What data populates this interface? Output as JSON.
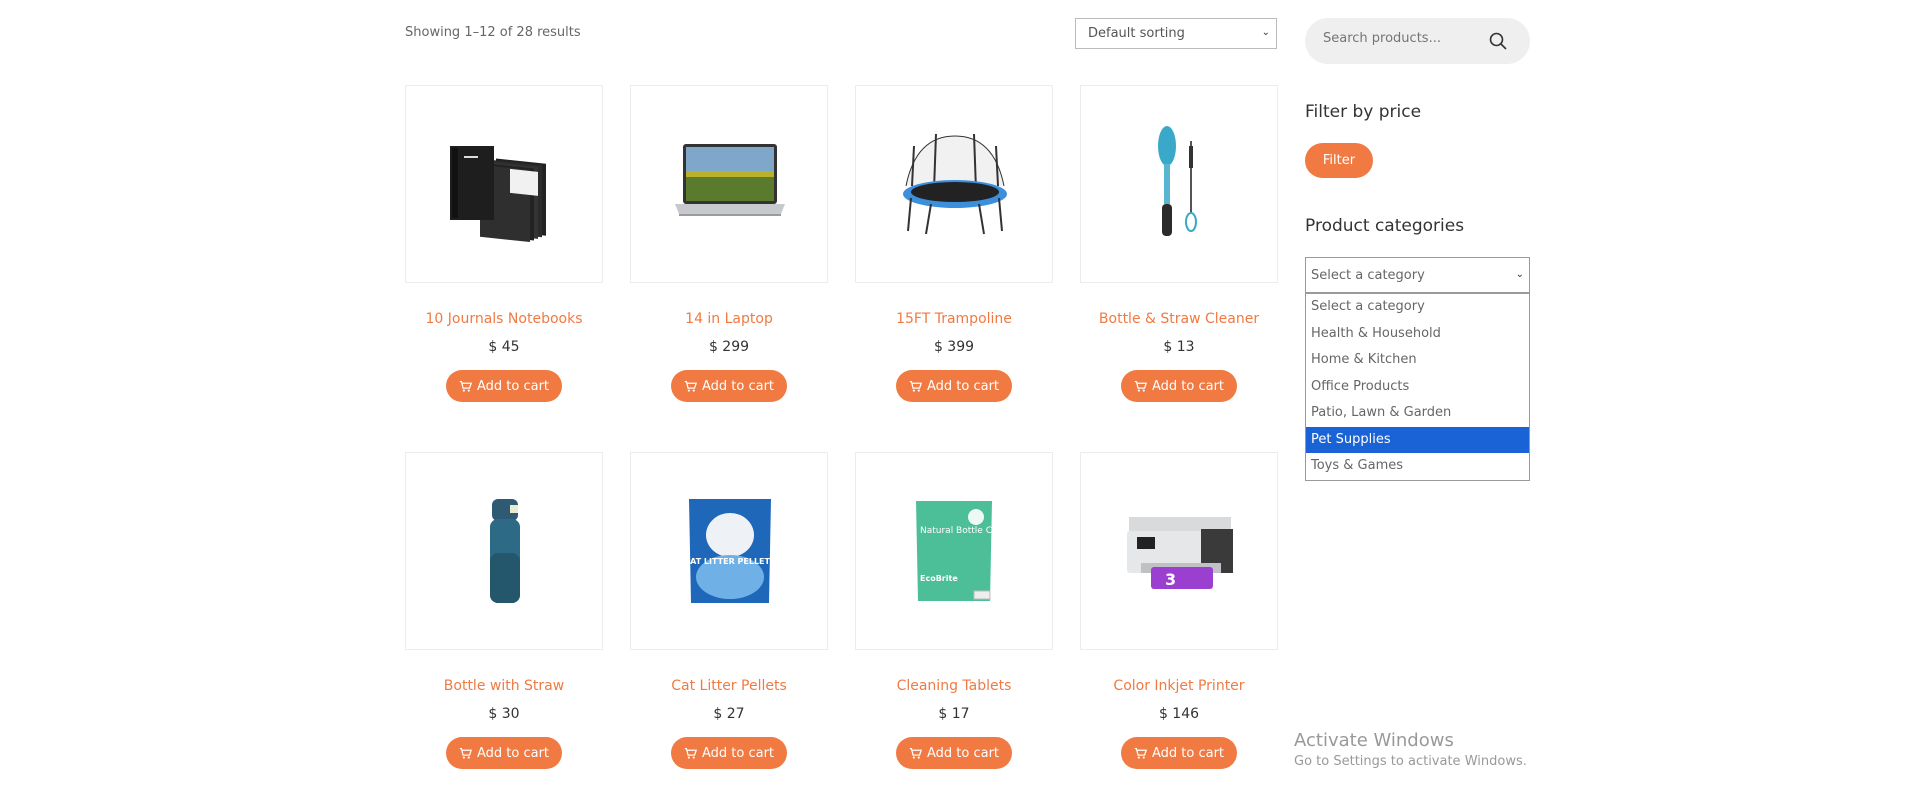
{
  "toolbar": {
    "result_count": "Showing 1–12 of 28 results",
    "sort_selected": "Default sorting"
  },
  "search": {
    "placeholder": "Search products..."
  },
  "filter_price": {
    "title": "Filter by price",
    "button": "Filter"
  },
  "categories": {
    "title": "Product categories",
    "selected": "Select a category",
    "options": [
      "Select a category",
      "Health & Household",
      "Home & Kitchen",
      "Office Products",
      "Patio, Lawn & Garden",
      "Pet Supplies",
      "Toys & Games"
    ],
    "highlighted": "Pet Supplies"
  },
  "products": [
    {
      "name": "10 Journals Notebooks",
      "price": "$ 45",
      "cart": "Add to cart",
      "image": "notebooks-image"
    },
    {
      "name": "14 in Laptop",
      "price": "$ 299",
      "cart": "Add to cart",
      "image": "laptop-image"
    },
    {
      "name": "15FT Trampoline",
      "price": "$ 399",
      "cart": "Add to cart",
      "image": "trampoline-image"
    },
    {
      "name": "Bottle & Straw Cleaner",
      "price": "$ 13",
      "cart": "Add to cart",
      "image": "brush-image"
    },
    {
      "name": "Bottle with Straw",
      "price": "$ 30",
      "cart": "Add to cart",
      "image": "bottle-image"
    },
    {
      "name": "Cat Litter Pellets",
      "price": "$ 27",
      "cart": "Add to cart",
      "image": "cat-litter-image"
    },
    {
      "name": "Cleaning Tablets",
      "price": "$ 17",
      "cart": "Add to cart",
      "image": "tablets-image"
    },
    {
      "name": "Color Inkjet Printer",
      "price": "$ 146",
      "cart": "Add to cart",
      "image": "printer-image"
    }
  ],
  "product_image_text": {
    "cat_litter": "CAT LITTER PELLETS",
    "tablets": "Natural Bottle Cleaning Tablets",
    "tablets_brand": "EcoBrite",
    "printer_badge": "3"
  },
  "watermark": {
    "line1": "Activate Windows",
    "line2": "Go to Settings to activate Windows."
  },
  "colors": {
    "accent": "#f07a42",
    "highlight": "#1a63d6"
  }
}
